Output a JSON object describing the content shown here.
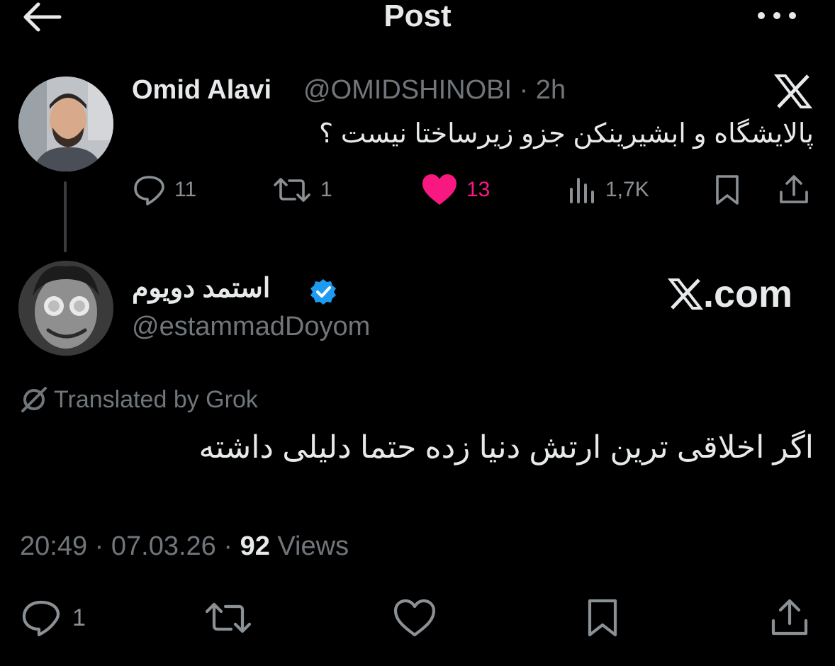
{
  "header": {
    "title": "Post"
  },
  "quoted_post": {
    "author_name": "Omid Alavi",
    "author_handle": "@OMIDSHINOBI · 2h",
    "text": "پالایشگاه و ابشیرینکن جزو زیرساختا نیست ؟",
    "stats": {
      "replies": "11",
      "reposts": "1",
      "likes": "13",
      "views": "1,7K"
    },
    "like_color": "#f91880"
  },
  "post": {
    "author_name": "استمد دویوم",
    "author_handle": "@estammadDoyom",
    "xcom_label": ".com",
    "translated_label": "Translated by Grok",
    "text": "اگر اخلاقی ترین ارتش دنیا زده حتما دلیلی داشته",
    "time": "20:49 · 07.03.26 · ",
    "views_count": "92",
    "views_label": " Views",
    "reply_count": "1",
    "verified_color": "#1d9bf0"
  }
}
